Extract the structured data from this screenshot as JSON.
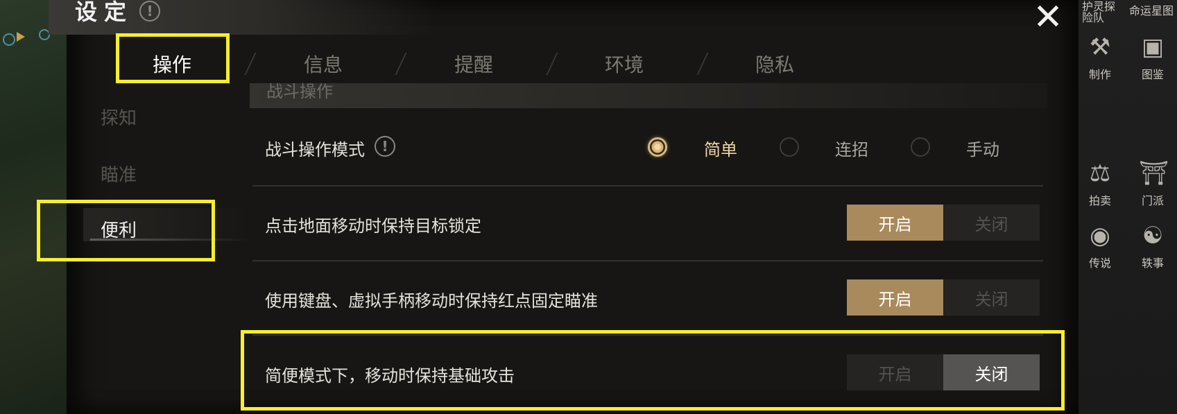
{
  "window": {
    "title": "设定",
    "close_icon": "close-icon"
  },
  "tabs": [
    {
      "label": "操作",
      "active": true
    },
    {
      "label": "信息",
      "active": false
    },
    {
      "label": "提醒",
      "active": false
    },
    {
      "label": "环境",
      "active": false
    },
    {
      "label": "隐私",
      "active": false
    }
  ],
  "sidebar": {
    "items": [
      {
        "label": "探知",
        "active": false
      },
      {
        "label": "瞄准",
        "active": false
      },
      {
        "label": "便利",
        "active": true
      }
    ]
  },
  "section": {
    "title": "战斗操作"
  },
  "settings": [
    {
      "label": "战斗操作模式",
      "type": "radio",
      "options": [
        "简单",
        "连招",
        "手动"
      ],
      "selected": "简单"
    },
    {
      "label": "点击地面移动时保持目标锁定",
      "type": "toggle",
      "on_label": "开启",
      "off_label": "关闭",
      "value": "开启"
    },
    {
      "label": "使用键盘、虚拟手柄移动时保持红点固定瞄准",
      "type": "toggle",
      "on_label": "开启",
      "off_label": "关闭",
      "value": "开启"
    },
    {
      "label": "简便模式下，移动时保持基础攻击",
      "type": "toggle",
      "on_label": "开启",
      "off_label": "关闭",
      "value": "关闭"
    }
  ],
  "right_rail": {
    "top_labels": [
      "护灵探险队",
      "命运星图"
    ],
    "items": [
      {
        "label": "制作",
        "icon": "crafting-icon"
      },
      {
        "label": "图鉴",
        "icon": "codex-icon"
      },
      {
        "label": "拍卖",
        "icon": "auction-icon"
      },
      {
        "label": "门派",
        "icon": "sect-icon"
      },
      {
        "label": "传说",
        "icon": "legend-icon"
      },
      {
        "label": "轶事",
        "icon": "anecdote-icon"
      }
    ]
  },
  "colors": {
    "highlight": "#f8ee2a",
    "toggle_on": "#a88a5c",
    "toggle_off": "#555452",
    "radio_selected": "#d9b77a"
  }
}
